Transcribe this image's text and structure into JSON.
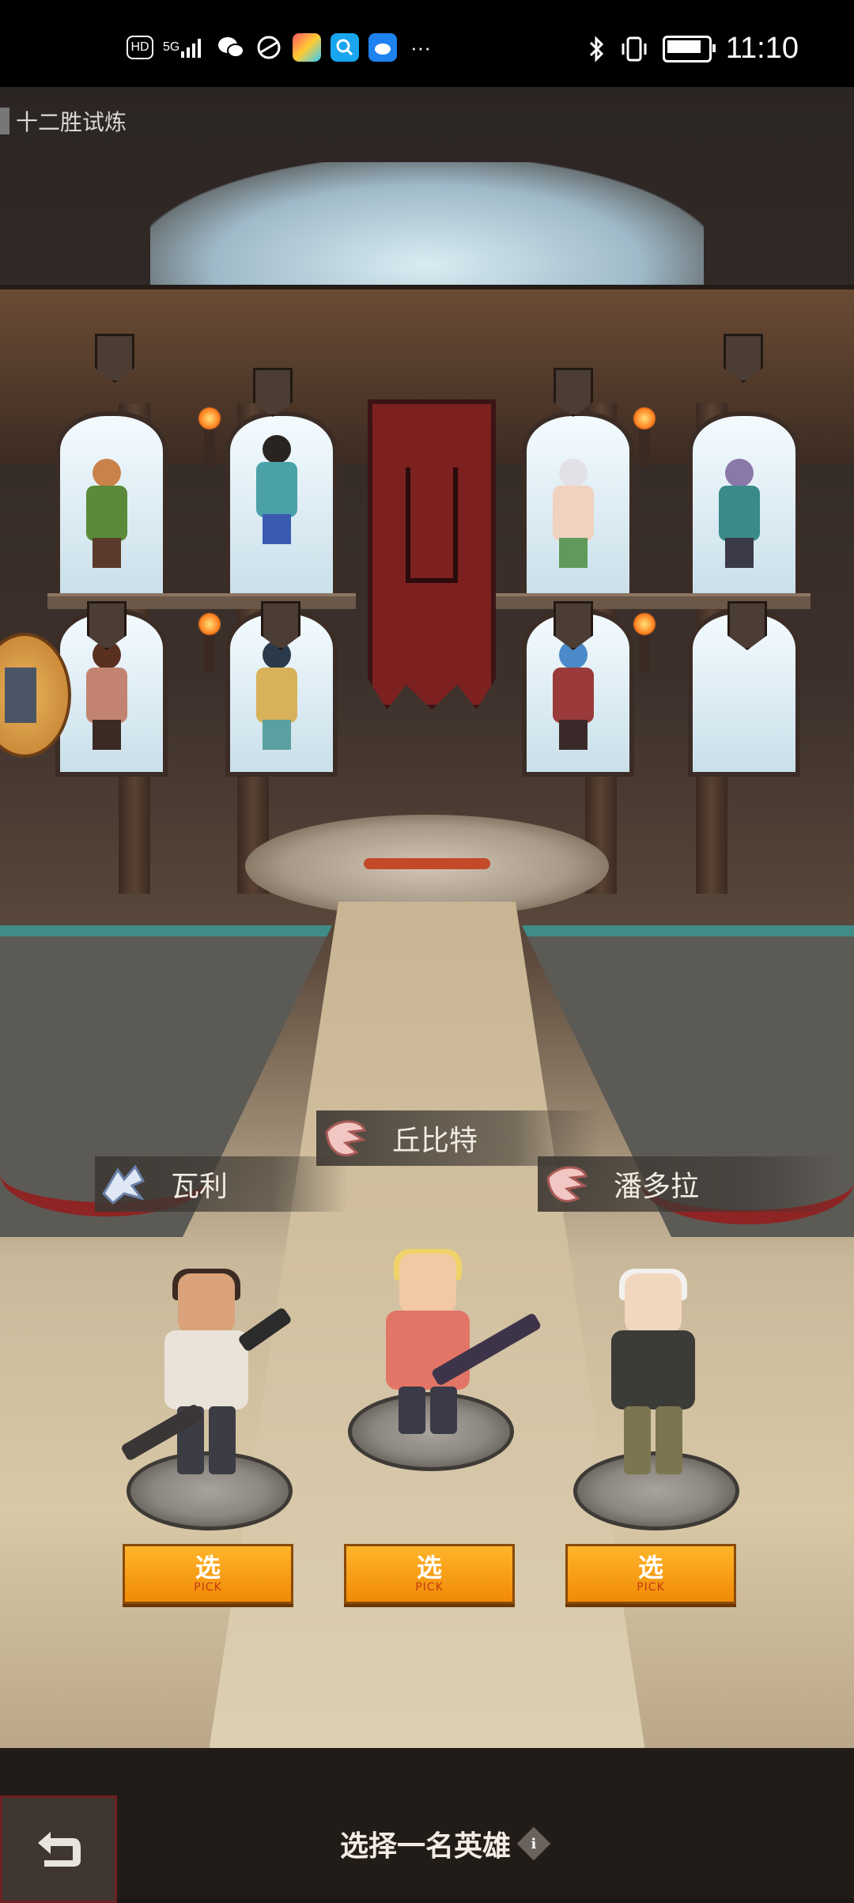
{
  "status_bar": {
    "time": "11:10",
    "left_icons": [
      "hd-icon",
      "signal-5g-icon",
      "wechat-icon",
      "browser-icon",
      "app-icon",
      "qq-icon",
      "weibo-icon",
      "more-icon"
    ],
    "right_icons": [
      "bluetooth-icon",
      "vibrate-icon",
      "battery-icon"
    ],
    "hd_label": "HD",
    "signal_label": "5G",
    "more_label": "···"
  },
  "mode_title": "十二胜试炼",
  "heroes": [
    {
      "name": "瓦利",
      "emblem": "wolf-emblem-icon",
      "pick_label": "选",
      "pick_sub": "PICK",
      "colors": {
        "hair": "#3a2a22",
        "skin": "#d9a27a",
        "torso": "#e9e3da",
        "legs": "#3c3c44"
      }
    },
    {
      "name": "丘比特",
      "emblem": "bird-emblem-icon",
      "pick_label": "选",
      "pick_sub": "PICK",
      "colors": {
        "hair": "#f0d26a",
        "skin": "#f2c9a4",
        "torso": "#e27566",
        "legs": "#3a3a48"
      }
    },
    {
      "name": "潘多拉",
      "emblem": "bird-emblem-icon",
      "pick_label": "选",
      "pick_sub": "PICK",
      "colors": {
        "hair": "#f3f1ee",
        "skin": "#f2d7bf",
        "torso": "#3b3b38",
        "legs": "#7c7650"
      }
    }
  ],
  "bottom": {
    "prompt": "选择一名英雄",
    "info_symbol": "i"
  },
  "colors": {
    "pick_button": "#f39a12",
    "banner": "#7d2020",
    "water_edge": "#3f8c88"
  }
}
